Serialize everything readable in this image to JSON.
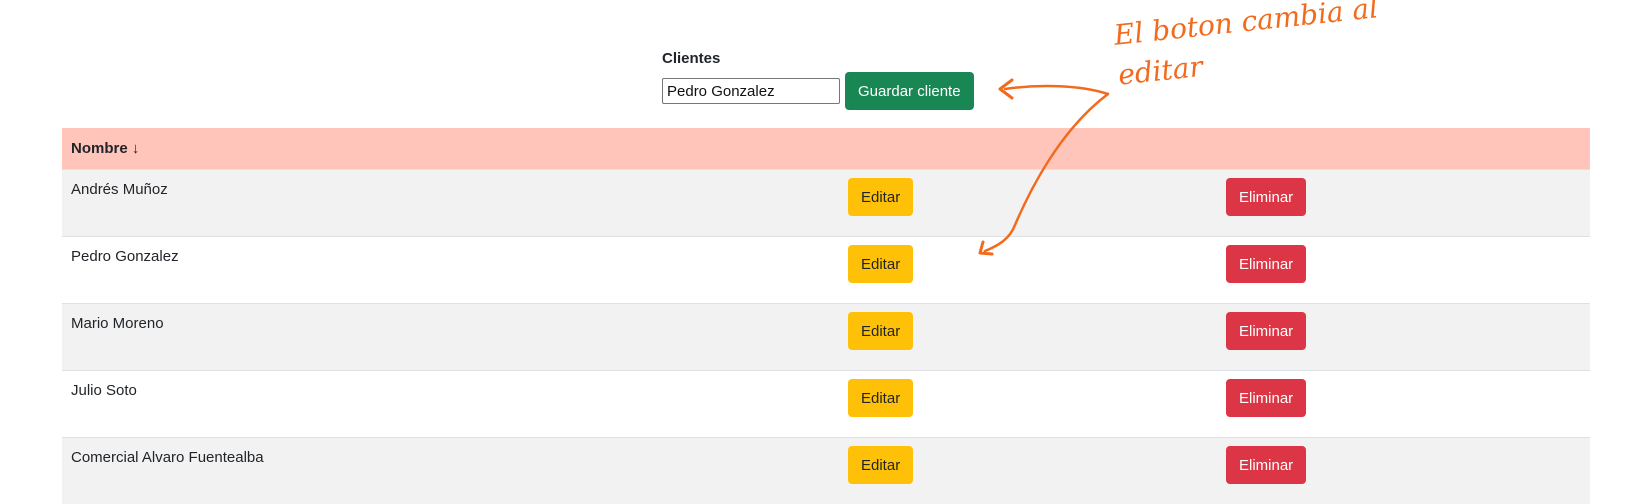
{
  "form": {
    "label": "Clientes",
    "input_value": "Pedro Gonzalez",
    "save_button": "Guardar cliente"
  },
  "table": {
    "header": {
      "name_col": "Nombre ↓"
    },
    "rows": [
      {
        "name": "Andrés Muñoz",
        "edit": "Editar",
        "delete": "Eliminar"
      },
      {
        "name": "Pedro Gonzalez",
        "edit": "Editar",
        "delete": "Eliminar"
      },
      {
        "name": "Mario Moreno",
        "edit": "Editar",
        "delete": "Eliminar"
      },
      {
        "name": "Julio Soto",
        "edit": "Editar",
        "delete": "Eliminar"
      },
      {
        "name": "Comercial Alvaro Fuentealba",
        "edit": "Editar",
        "delete": "Eliminar"
      }
    ]
  },
  "annotation": {
    "text": "El boton cambia al editar",
    "color": "#f26b1d"
  },
  "colors": {
    "success": "#198754",
    "warning": "#ffc107",
    "danger": "#dc3545",
    "header_bg": "#ffc5ba",
    "striped_row": "#f2f2f2"
  }
}
